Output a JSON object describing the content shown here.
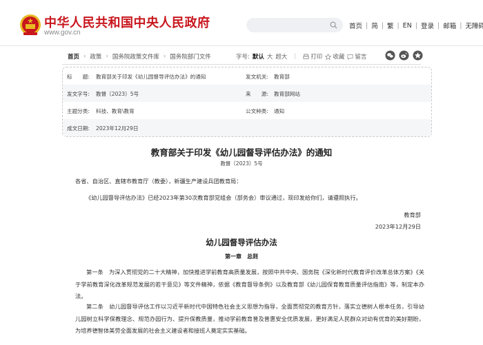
{
  "header": {
    "site_title": "中华人民共和国中央人民政府",
    "site_url": "www.gov.cn",
    "search_placeholder": "",
    "nav": [
      "首页",
      "简",
      "繁",
      "EN",
      "登录",
      "邮箱",
      "无障碍"
    ]
  },
  "breadcrumb": [
    "首页",
    "政策",
    "国务院政策文件库",
    "国务院部门文件"
  ],
  "tools": {
    "font_label": "字号:",
    "font_default": "默认",
    "font_large": "大",
    "font_xlarge": "超大",
    "print": "打印",
    "favorite": "收藏",
    "comment": "留言",
    "icons": [
      "print-icon",
      "star-icon",
      "comment-icon",
      "wechat-icon",
      "weibo-icon",
      "qzone-icon"
    ]
  },
  "info": {
    "title_label": "标　　题:",
    "title_value": "教育部关于印发《幼儿园督导评估办法》的通知",
    "issuer_label": "发文机关:",
    "issuer_value": "教育部",
    "doc_no_label": "发文字号:",
    "doc_no_value": "教督〔2023〕5号",
    "source_label": "来　　源:",
    "source_value": "教育部网站",
    "category_label": "主题分类:",
    "category_value": "科技、教育\\教育",
    "type_label": "公文种类:",
    "type_value": "通知",
    "date_label": "成文日期:",
    "date_value": "2023年12月29日"
  },
  "article": {
    "title": "教育部关于印发《幼儿园督导评估办法》的通知",
    "number": "教督〔2023〕5号",
    "addressee": "各省、自治区、直辖市教育厅（教委），新疆生产建设兵团教育局：",
    "body": "《幼儿园督导评估办法》已经2023年第30次教育部党组会（部务会）审议通过，现印发给你们，请遵照执行。",
    "signature": "教育部",
    "date": "2023年12月29日",
    "subtitle": "幼儿园督导评估办法",
    "chapter": "第一章　总则",
    "article1": "第一条　为深入贯彻党的二十大精神，加快推进学前教育高质量发展，按照中共中央、国务院《深化新时代教育评价改革总体方案》《关于学前教育深化改革规范发展的若干意见》等文件精神，依据《教育督导条例》以及教育部《幼儿园保育教育质量评估指南》等，制定本办法。",
    "article2": "第二条　幼儿园督导评估工作以习近平新时代中国特色社会主义思想为指导，全面贯彻党的教育方针，落实立德树人根本任务，引导幼儿园树立科学保教理念、规范办园行为、提升保教质量，推动学前教育普及普惠安全优质发展，更好满足人民群众对幼有优育的美好期盼，为培养德智体美劳全面发展的社会主义建设者和接班人奠定实实基础。"
  },
  "colors": {
    "brand_red": "#c8161d",
    "emblem_gold": "#e8b923"
  }
}
